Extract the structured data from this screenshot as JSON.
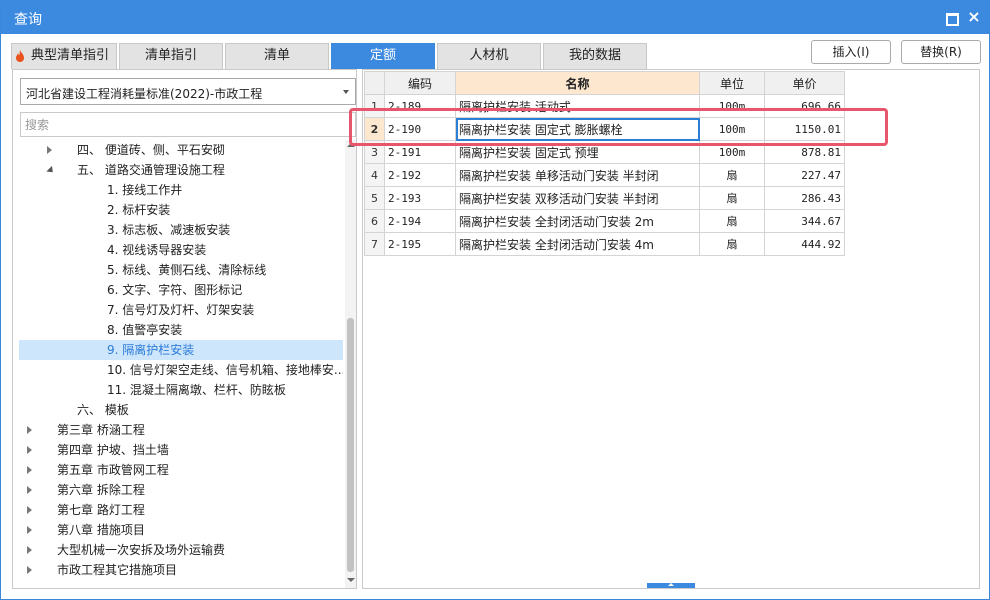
{
  "window": {
    "title": "查询"
  },
  "tabs": [
    {
      "label": "典型清单指引",
      "active": false
    },
    {
      "label": "清单指引",
      "active": false
    },
    {
      "label": "清单",
      "active": false
    },
    {
      "label": "定额",
      "active": true
    },
    {
      "label": "人材机",
      "active": false
    },
    {
      "label": "我的数据",
      "active": false
    }
  ],
  "actions": {
    "insert": "插入(I)",
    "replace": "替换(R)"
  },
  "left": {
    "library": "河北省建设工程消耗量标准(2022)-市政工程",
    "search_placeholder": "搜索",
    "tree": [
      {
        "label": "四、 便道砖、侧、平石安砌",
        "expander": "collapsed",
        "selected": false
      },
      {
        "label": "五、 道路交通管理设施工程",
        "expander": "expanded",
        "selected": false
      },
      {
        "label": "1. 接线工作井",
        "expander": "none",
        "selected": false
      },
      {
        "label": "2. 标杆安装",
        "expander": "none",
        "selected": false
      },
      {
        "label": "3. 标志板、减速板安装",
        "expander": "none",
        "selected": false
      },
      {
        "label": "4. 视线诱导器安装",
        "expander": "none",
        "selected": false
      },
      {
        "label": "5. 标线、黄侧石线、清除标线",
        "expander": "none",
        "selected": false
      },
      {
        "label": "6. 文字、字符、图形标记",
        "expander": "none",
        "selected": false
      },
      {
        "label": "7. 信号灯及灯杆、灯架安装",
        "expander": "none",
        "selected": false
      },
      {
        "label": "8. 值警亭安装",
        "expander": "none",
        "selected": false
      },
      {
        "label": "9. 隔离护栏安装",
        "expander": "none",
        "selected": true
      },
      {
        "label": "10. 信号灯架空走线、信号机箱、接地棒安...",
        "expander": "none",
        "selected": false
      },
      {
        "label": "11. 混凝土隔离墩、栏杆、防眩板",
        "expander": "none",
        "selected": false
      },
      {
        "label": "六、 模板",
        "expander": "none",
        "selected": false
      },
      {
        "label": "第三章 桥涵工程",
        "expander": "collapsed",
        "selected": false
      },
      {
        "label": "第四章 护坡、挡土墙",
        "expander": "collapsed",
        "selected": false
      },
      {
        "label": "第五章 市政管网工程",
        "expander": "collapsed",
        "selected": false
      },
      {
        "label": "第六章 拆除工程",
        "expander": "collapsed",
        "selected": false
      },
      {
        "label": "第七章 路灯工程",
        "expander": "collapsed",
        "selected": false
      },
      {
        "label": "第八章 措施项目",
        "expander": "collapsed",
        "selected": false
      },
      {
        "label": "大型机械一次安拆及场外运输费",
        "expander": "collapsed",
        "selected": false
      },
      {
        "label": "市政工程其它措施项目",
        "expander": "collapsed",
        "selected": false
      }
    ]
  },
  "grid": {
    "headers": {
      "code": "编码",
      "name": "名称",
      "unit": "单位",
      "price": "单价"
    },
    "rows": [
      {
        "n": "1",
        "code": "2-189",
        "name": "隔离护栏安装 活动式",
        "unit": "100m",
        "price": "696.66"
      },
      {
        "n": "2",
        "code": "2-190",
        "name": "隔离护栏安装 固定式 膨胀螺栓",
        "unit": "100m",
        "price": "1150.01"
      },
      {
        "n": "3",
        "code": "2-191",
        "name": "隔离护栏安装 固定式 预埋",
        "unit": "100m",
        "price": "878.81"
      },
      {
        "n": "4",
        "code": "2-192",
        "name": "隔离护栏安装 单移活动门安装 半封闭",
        "unit": "扇",
        "price": "227.47"
      },
      {
        "n": "5",
        "code": "2-193",
        "name": "隔离护栏安装 双移活动门安装 半封闭",
        "unit": "扇",
        "price": "286.43"
      },
      {
        "n": "6",
        "code": "2-194",
        "name": "隔离护栏安装 全封闭活动门安装 2m",
        "unit": "扇",
        "price": "344.67"
      },
      {
        "n": "7",
        "code": "2-195",
        "name": "隔离护栏安装 全封闭活动门安装 4m",
        "unit": "扇",
        "price": "444.92"
      }
    ],
    "active_row": 1
  }
}
